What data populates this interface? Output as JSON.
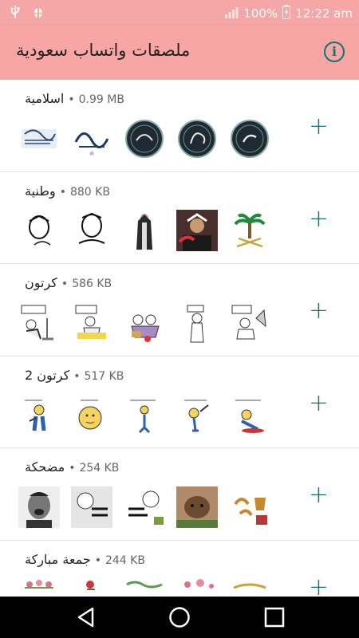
{
  "status": {
    "battery": "100%",
    "time": "12:22 am"
  },
  "appbar": {
    "title": "ملصقات واتساب سعودية",
    "info_icon": "info-icon"
  },
  "packs": [
    {
      "name": "اسلامية",
      "size": "0.99 MB"
    },
    {
      "name": "وطنية",
      "size": "880 KB"
    },
    {
      "name": "كرتون",
      "size": "586 KB"
    },
    {
      "name": "كرتون 2",
      "size": "517 KB"
    },
    {
      "name": "مضحكة",
      "size": "254 KB"
    },
    {
      "name": "جمعة مباركة",
      "size": "244 KB"
    }
  ],
  "separator": "•",
  "add_symbol": "+",
  "colors": {
    "accent": "#0f766e",
    "appbar": "#f8a5a5"
  }
}
